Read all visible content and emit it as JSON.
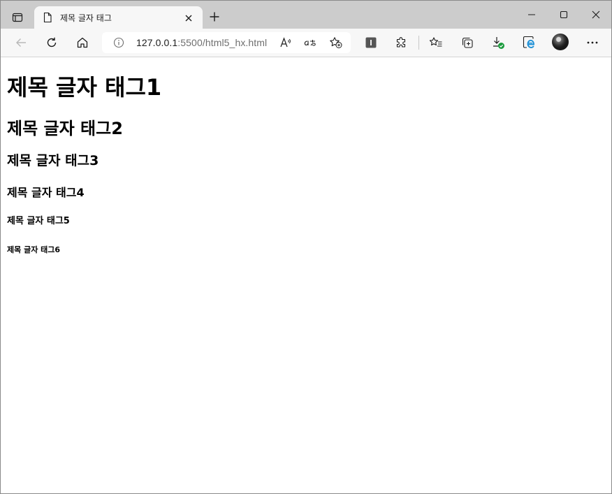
{
  "browser": {
    "tab": {
      "title": "제목 글자 태그",
      "page_icon": "document-icon",
      "close_icon": "close-icon"
    },
    "new_tab_icon": "plus-icon",
    "window_controls": [
      "minimize-icon",
      "maximize-icon",
      "close-icon"
    ],
    "toolbar": {
      "back_icon": "back-arrow-icon",
      "refresh_icon": "refresh-icon",
      "home_icon": "home-icon",
      "address": {
        "info_icon": "info-icon",
        "url_host": "127.0.0.1",
        "url_rest": ":5500/html5_hx.html",
        "read_aloud_icon": "read-aloud-icon",
        "translate_icon": "translate-icon",
        "favorite_add_icon": "star-add-icon"
      },
      "extension_icon": "extension-box-icon",
      "extensions_icon": "puzzle-icon",
      "favorites_icon": "favorites-list-icon",
      "collections_icon": "collections-icon",
      "downloads_icon": "download-icon",
      "ie_mode_icon": "ie-mode-icon",
      "profile_icon": "avatar",
      "menu_icon": "more-icon"
    }
  },
  "page": {
    "h1": "제목 글자 태그1",
    "h2": "제목 글자 태그2",
    "h3": "제목 글자 태그3",
    "h4": "제목 글자 태그4",
    "h5": "제목 글자 태그5",
    "h6": "제목 글자 태그6"
  },
  "colors": {
    "tabstrip": "#cccccc",
    "toolbar": "#f7f7f7",
    "download_badge": "#1a9b3c",
    "ie_blue": "#1e90d6"
  }
}
